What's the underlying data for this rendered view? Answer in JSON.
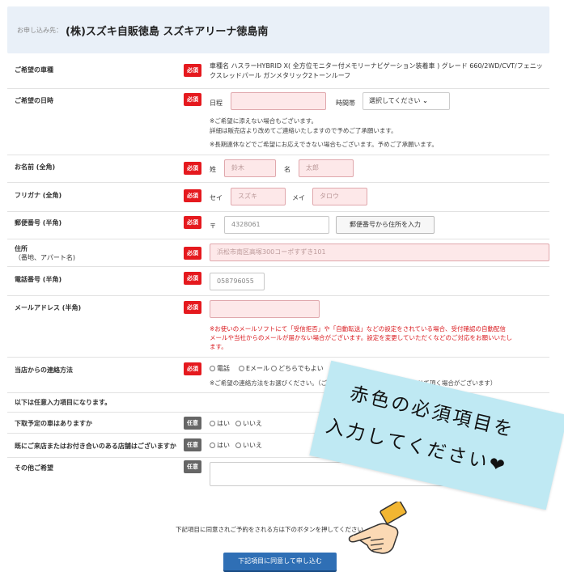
{
  "header": {
    "prefix": "お申し込み先：",
    "shop_name": "(株)スズキ自販徳島 スズキアリーナ徳島南"
  },
  "badges": {
    "required": "必須",
    "optional": "任意"
  },
  "vehicle": {
    "label": "ご希望の車種",
    "value_line1": "車種名 ハスラーHYBRID X( 全方位モニター付メモリーナビゲーション装着車 ) グレード 660/2WD/CVT/フェニッ",
    "value_line2": "クスレッドパール ガンメタリック2トーンルーフ"
  },
  "datetime": {
    "label": "ご希望の日時",
    "date_label": "日程",
    "time_label": "時間帯",
    "time_select": "選択してください",
    "note1": "※ご希望に添えない場合もございます。",
    "note2": "詳細は販売店より改めてご連絡いたしますので予めご了承願います。",
    "note3": "※長期連休などでご希望にお応えできない場合もございます。予めご了承願います。"
  },
  "name": {
    "label": "お名前 (全角)",
    "sei_label": "姓",
    "sei_placeholder": "鈴木",
    "mei_label": "名",
    "mei_placeholder": "太郎"
  },
  "furigana": {
    "label": "フリガナ (全角)",
    "sei_label": "セイ",
    "sei_placeholder": "スズキ",
    "mei_label": "メイ",
    "mei_placeholder": "タロウ"
  },
  "postal": {
    "label": "郵便番号 (半角)",
    "mark": "〒",
    "placeholder": "4328061",
    "button": "郵便番号から住所を入力"
  },
  "address": {
    "label1": "住所",
    "label2": "（番地、アパート名)",
    "placeholder": "浜松市南区高塚300コーポすずき101"
  },
  "phone": {
    "label": "電話番号 (半角)",
    "placeholder": "058796055"
  },
  "email": {
    "label": "メールアドレス (半角)",
    "warn1": "※お使いのメールソフトにて「受信拒否」や「自動転送」などの設定をされている場合、受付確認の自動配信",
    "warn2": "メールや当社からのメールが届かない場合がございます。設定を変更していただくなどのご対応をお願いいたし",
    "warn3": "ます。"
  },
  "contact": {
    "label": "当店からの連絡方法",
    "options": [
      "電話",
      "Eメール",
      "どちらでもよい"
    ],
    "note": "※ご希望の連絡方法をお選びください。（ご回答にかかわらず、直接お電話させて頂く場合がございます）"
  },
  "optional_heading": "以下は任意入力項目になります。",
  "tradein": {
    "label": "下取予定の車はありますか",
    "options": [
      "はい",
      "いいえ"
    ]
  },
  "visited": {
    "label": "既にご来店またはお付き合いのある店舗はございますか",
    "options": [
      "はい",
      "いいえ"
    ]
  },
  "other": {
    "label": "その他ご希望"
  },
  "agree_text": "下記項目に同意されご予約をされる方は下のボタンを押してください。",
  "submit_label": "下記項目に同意して申し込む",
  "overlay": {
    "line1": "赤色の必須項目を",
    "line2": "入力してください❤",
    "note_color": "#bfe9f3"
  },
  "colors": {
    "required": "#e5191e",
    "optional": "#666666",
    "submit": "#2f6fb5",
    "header_bg": "#e9f0f8"
  }
}
